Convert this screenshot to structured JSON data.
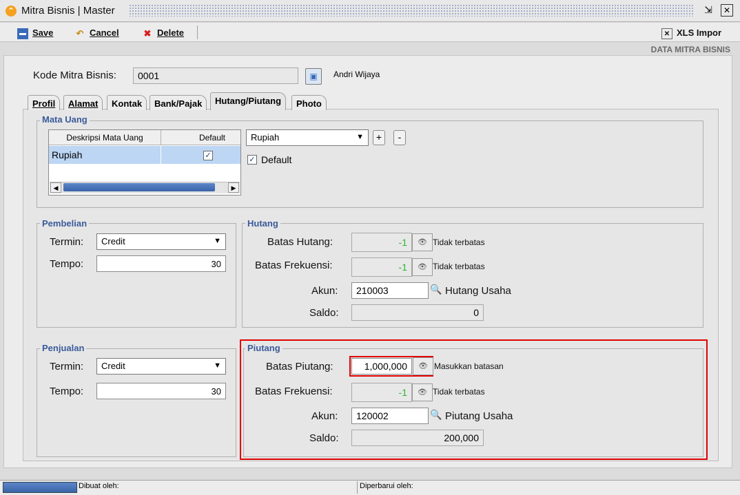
{
  "window": {
    "title": "Mitra Bisnis | Master",
    "restore_glyph": "⇲",
    "close_glyph": "✕"
  },
  "toolbar": {
    "save": "Save",
    "cancel": "Cancel",
    "delete": "Delete",
    "xls_import": "XLS Impor"
  },
  "header_label": "DATA MITRA BISNIS",
  "kode": {
    "label": "Kode Mitra Bisnis:",
    "value": "0001",
    "name": "Andri Wijaya"
  },
  "tabs": [
    "Profil",
    "Alamat",
    "Kontak",
    "Bank/Pajak",
    "Hutang/Piutang",
    "Photo"
  ],
  "active_tab": "Hutang/Piutang",
  "mata_uang": {
    "legend": "Mata Uang",
    "columns": [
      "Deskripsi Mata Uang",
      "Default"
    ],
    "rows": [
      {
        "desc": "Rupiah",
        "default": true
      }
    ],
    "select_value": "Rupiah",
    "add": "+",
    "remove": "-",
    "default_label": "Default",
    "default_checked": true
  },
  "pembelian": {
    "legend": "Pembelian",
    "termin_label": "Termin:",
    "termin_value": "Credit",
    "tempo_label": "Tempo:",
    "tempo_value": "30"
  },
  "penjualan": {
    "legend": "Penjualan",
    "termin_label": "Termin:",
    "termin_value": "Credit",
    "tempo_label": "Tempo:",
    "tempo_value": "30"
  },
  "hutang": {
    "legend": "Hutang",
    "batas_label": "Batas Hutang:",
    "batas_value": "-1",
    "batas_note": "Tidak terbatas",
    "frek_label": "Batas Frekuensi:",
    "frek_value": "-1",
    "frek_note": "Tidak terbatas",
    "akun_label": "Akun:",
    "akun_value": "210003",
    "akun_name": "Hutang Usaha",
    "saldo_label": "Saldo:",
    "saldo_value": "0"
  },
  "piutang": {
    "legend": "Piutang",
    "batas_label": "Batas Piutang:",
    "batas_value": "1,000,000",
    "batas_note": "Masukkan batasan",
    "frek_label": "Batas Frekuensi:",
    "frek_value": "-1",
    "frek_note": "Tidak terbatas",
    "akun_label": "Akun:",
    "akun_value": "120002",
    "akun_name": "Piutang Usaha",
    "saldo_label": "Saldo:",
    "saldo_value": "200,000"
  },
  "status": {
    "created_by": "Dibuat oleh:",
    "updated_by": "Diperbarui oleh:"
  },
  "colors": {
    "highlight_red": "#e00000",
    "legend_blue": "#3a5a9a",
    "row_selected": "#bcd6f4",
    "green_value": "#2db52d"
  }
}
